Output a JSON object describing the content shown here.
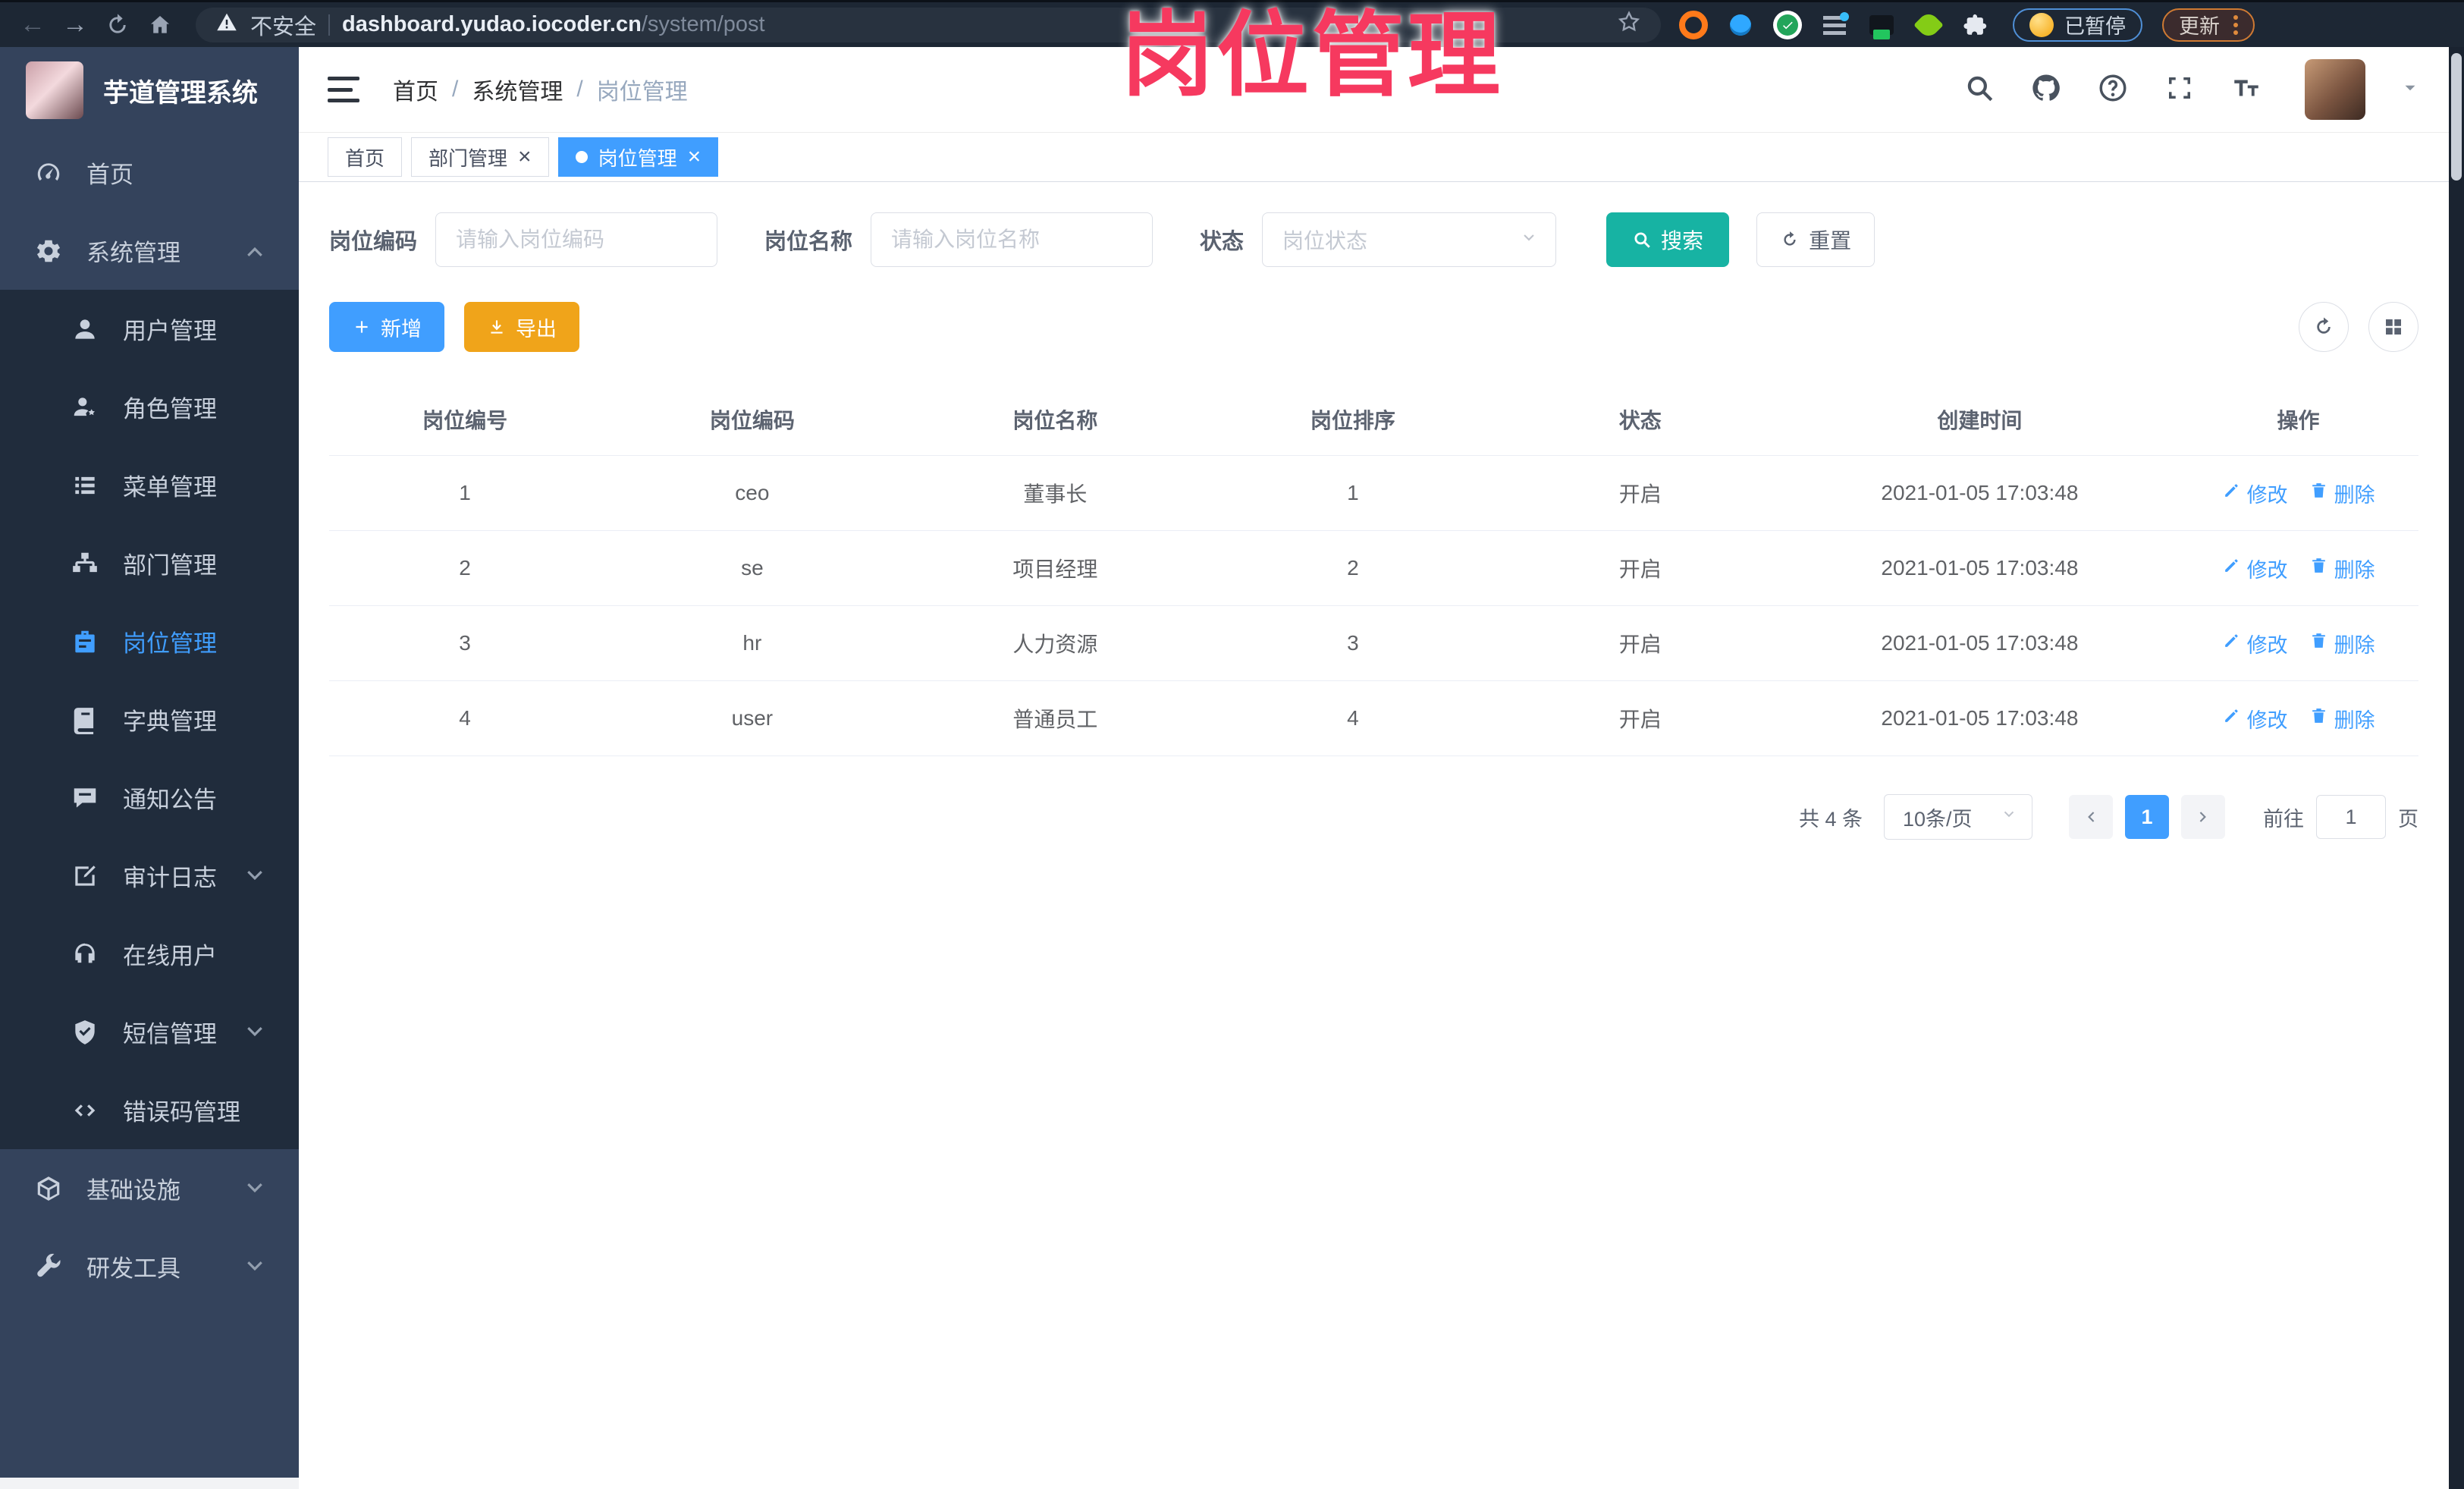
{
  "browser": {
    "security_label": "不安全",
    "url_host": "dashboard.yudao.iocoder.cn",
    "url_path": "/system/post",
    "paused_label": "已暂停",
    "update_label": "更新",
    "extensions": [
      "ext-orange-ring",
      "ext-blue-pin",
      "ext-green-check",
      "ext-sliders",
      "ext-crx",
      "ext-leaf",
      "ext-puzzle"
    ]
  },
  "overlay_title": "岗位管理",
  "sidebar": {
    "app_title": "芋道管理系统",
    "items": [
      {
        "id": "home",
        "label": "首页",
        "icon": "gauge",
        "level": "root"
      },
      {
        "id": "system",
        "label": "系统管理",
        "icon": "gear",
        "level": "root",
        "chevron": "up"
      },
      {
        "id": "user",
        "label": "用户管理",
        "icon": "user",
        "level": "sub"
      },
      {
        "id": "role",
        "label": "角色管理",
        "icon": "role",
        "level": "sub"
      },
      {
        "id": "menu",
        "label": "菜单管理",
        "icon": "menu-list",
        "level": "sub"
      },
      {
        "id": "dept",
        "label": "部门管理",
        "icon": "dept",
        "level": "sub"
      },
      {
        "id": "post",
        "label": "岗位管理",
        "icon": "post",
        "level": "sub",
        "active": true
      },
      {
        "id": "dict",
        "label": "字典管理",
        "icon": "dict",
        "level": "sub"
      },
      {
        "id": "notice",
        "label": "通知公告",
        "icon": "notice",
        "level": "sub"
      },
      {
        "id": "audit",
        "label": "审计日志",
        "icon": "audit",
        "level": "sub",
        "chevron": "down"
      },
      {
        "id": "online",
        "label": "在线用户",
        "icon": "online",
        "level": "sub"
      },
      {
        "id": "sms",
        "label": "短信管理",
        "icon": "sms",
        "level": "sub",
        "chevron": "down"
      },
      {
        "id": "errcode",
        "label": "错误码管理",
        "icon": "errcode",
        "level": "sub"
      },
      {
        "id": "infra",
        "label": "基础设施",
        "icon": "infra",
        "level": "root",
        "chevron": "down"
      },
      {
        "id": "devtools",
        "label": "研发工具",
        "icon": "devtools",
        "level": "root",
        "chevron": "down"
      }
    ]
  },
  "header": {
    "breadcrumb": [
      "首页",
      "系统管理",
      "岗位管理"
    ]
  },
  "tabs": [
    {
      "label": "首页",
      "closable": false,
      "active": false
    },
    {
      "label": "部门管理",
      "closable": true,
      "active": false
    },
    {
      "label": "岗位管理",
      "closable": true,
      "active": true
    }
  ],
  "filters": {
    "code_label": "岗位编码",
    "code_placeholder": "请输入岗位编码",
    "name_label": "岗位名称",
    "name_placeholder": "请输入岗位名称",
    "status_label": "状态",
    "status_placeholder": "岗位状态",
    "search_label": "搜索",
    "reset_label": "重置"
  },
  "toolbar": {
    "add_label": "新增",
    "export_label": "导出"
  },
  "table": {
    "columns": [
      "岗位编号",
      "岗位编码",
      "岗位名称",
      "岗位排序",
      "状态",
      "创建时间",
      "操作"
    ],
    "rows": [
      [
        "1",
        "ceo",
        "董事长",
        "1",
        "开启",
        "2021-01-05 17:03:48"
      ],
      [
        "2",
        "se",
        "项目经理",
        "2",
        "开启",
        "2021-01-05 17:03:48"
      ],
      [
        "3",
        "hr",
        "人力资源",
        "3",
        "开启",
        "2021-01-05 17:03:48"
      ],
      [
        "4",
        "user",
        "普通员工",
        "4",
        "开启",
        "2021-01-05 17:03:48"
      ]
    ],
    "edit_label": "修改",
    "delete_label": "删除"
  },
  "pagination": {
    "total_text": "共 4 条",
    "page_size": "10条/页",
    "current_page": "1",
    "goto_label": "前往",
    "goto_value": "1",
    "page_suffix": "页"
  },
  "colors": {
    "accent_blue": "#409EFF",
    "search_teal": "#17b3a3",
    "export_orange": "#f0a41a",
    "overlay_pink": "#f6395f",
    "sidebar_bg": "#34435c",
    "submenu_bg": "#202c3c"
  }
}
